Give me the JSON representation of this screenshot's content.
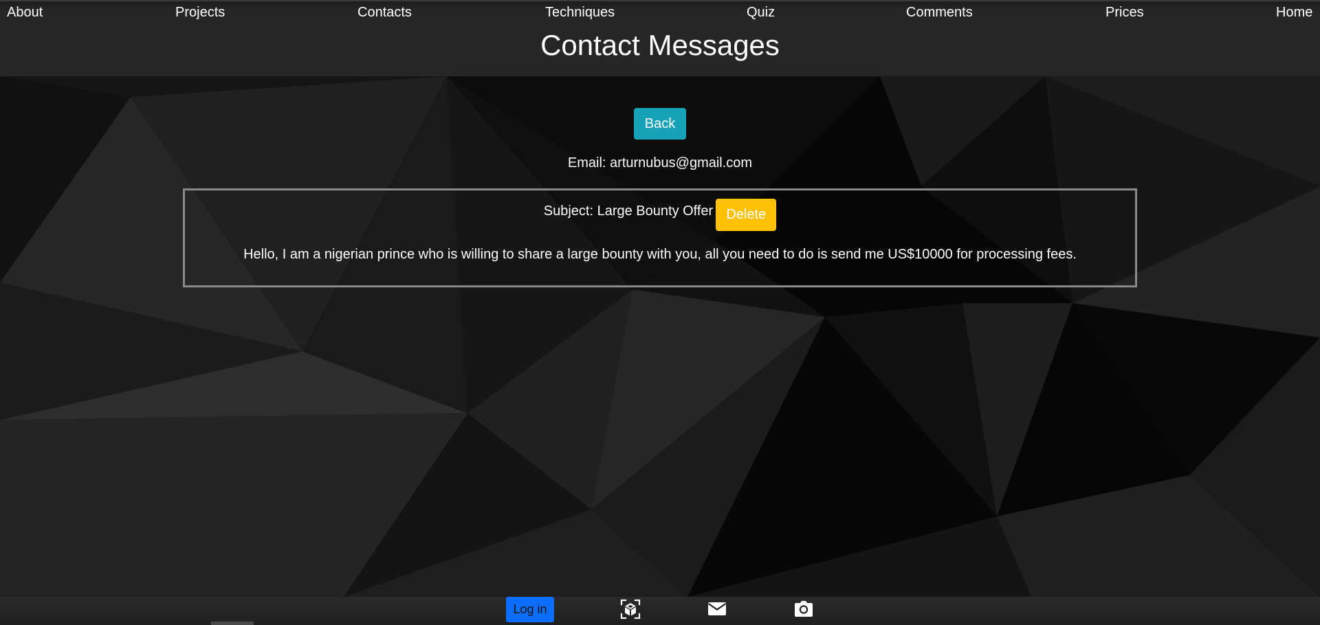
{
  "nav": {
    "items": [
      {
        "label": "About"
      },
      {
        "label": "Projects"
      },
      {
        "label": "Contacts"
      },
      {
        "label": "Techniques"
      },
      {
        "label": "Quiz"
      },
      {
        "label": "Comments"
      },
      {
        "label": "Prices"
      },
      {
        "label": "Home"
      }
    ]
  },
  "header": {
    "title": "Contact Messages"
  },
  "content": {
    "back_label": "Back",
    "email_line": "Email: arturnubus@gmail.com",
    "message": {
      "subject_line": "Subject: Large Bounty Offer",
      "delete_label": "Delete",
      "body": "Hello, I am a nigerian prince who is willing to share a large bounty with you, all you need to do is send me US$10000 for processing fees."
    }
  },
  "footer": {
    "login_label": "Log in",
    "icons": [
      "ar-cube-icon",
      "mail-icon",
      "camera-icon"
    ]
  },
  "colors": {
    "back_button": "#17a2b8",
    "delete_button": "#ffc107",
    "login_button": "#0d6efd"
  }
}
